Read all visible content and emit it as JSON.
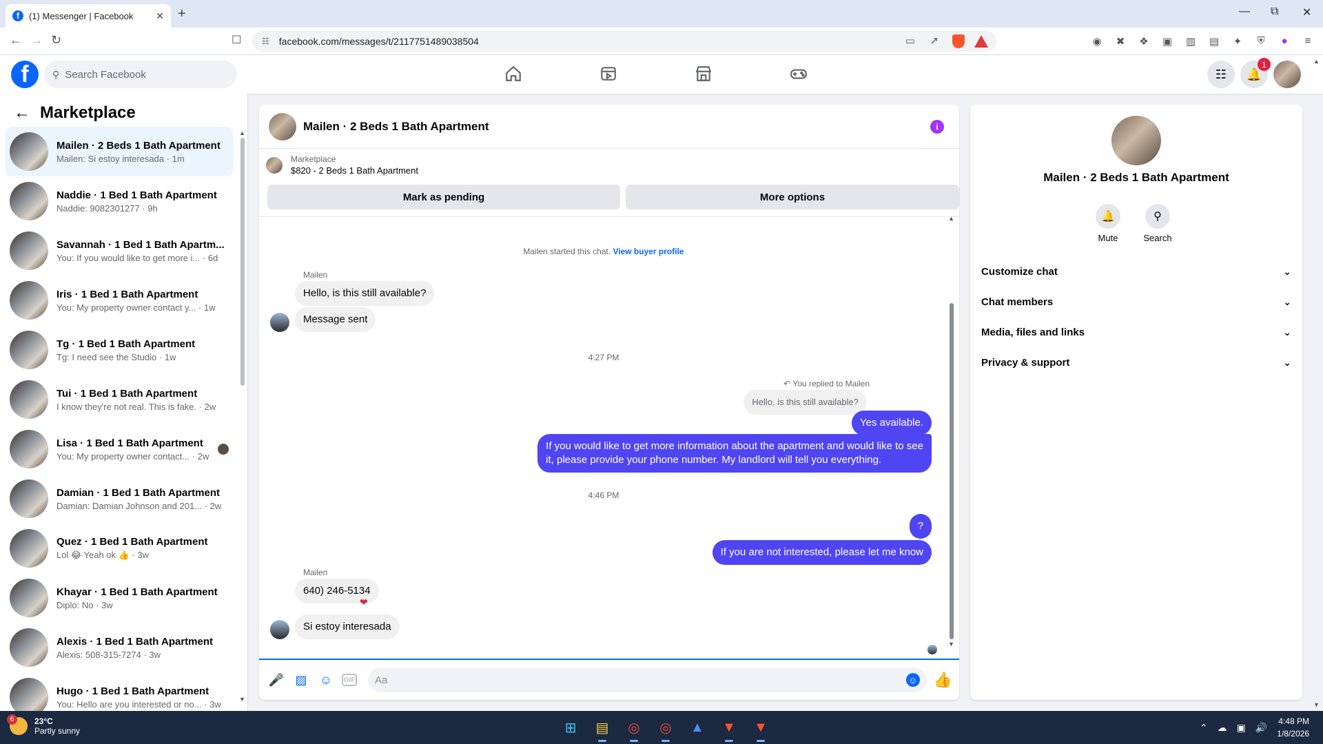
{
  "browser": {
    "tab_title": "(1) Messenger | Facebook",
    "url": "facebook.com/messages/t/2117751489038504",
    "new_tab": "+",
    "close_tab": "✕"
  },
  "fb": {
    "logo": "f",
    "search_placeholder": "Search Facebook",
    "notification_count": "1",
    "nav_icons": [
      "home-icon",
      "video-icon",
      "marketplace-icon",
      "gaming-icon"
    ]
  },
  "sidebar": {
    "title": "Marketplace",
    "conversations": [
      {
        "name": "Mailen · 2 Beds 1 Bath Apartment",
        "preview": "Mailen: Si estoy interesada · 1m",
        "active": true
      },
      {
        "name": "Naddie · 1 Bed 1 Bath Apartment",
        "preview": "Naddie: 9082301277 · 9h"
      },
      {
        "name": "Savannah · 1 Bed 1 Bath Apartm...",
        "preview": "You: If you would like to get more i... · 6d"
      },
      {
        "name": "Iris · 1 Bed 1 Bath Apartment",
        "preview": "You: My property owner contact y... · 1w"
      },
      {
        "name": "Tg · 1 Bed 1 Bath Apartment",
        "preview": "Tg: I need see the Studio · 1w"
      },
      {
        "name": "Tui · 1 Bed 1 Bath Apartment",
        "preview": "I know they're not real. This is fake. · 2w"
      },
      {
        "name": "Lisa · 1 Bed 1 Bath Apartment",
        "preview": "You: My property owner contact... · 2w",
        "seen": true
      },
      {
        "name": "Damian · 1 Bed 1 Bath Apartment",
        "preview": "Damian: Damian Johnson and 201... · 2w"
      },
      {
        "name": "Quez · 1 Bed 1 Bath Apartment",
        "preview": "Lol 😂 Yeah ok 👍 · 3w"
      },
      {
        "name": "Khayar · 1 Bed 1 Bath Apartment",
        "preview": "Diplo: No · 3w"
      },
      {
        "name": "Alexis · 1 Bed 1 Bath Apartment",
        "preview": "Alexis: 508-315-7274 · 3w"
      },
      {
        "name": "Hugo · 1 Bed 1 Bath Apartment",
        "preview": "You: Hello are you interested or no... · 3w"
      }
    ]
  },
  "chat": {
    "title": "Mailen · 2 Beds 1 Bath Apartment",
    "marketplace_label": "Marketplace",
    "listing": "$820 - 2 Beds 1 Bath Apartment",
    "mark_pending": "Mark as pending",
    "more_options": "More options",
    "system_text": "Mailen started this chat.",
    "system_link": "View buyer profile",
    "sender_name": "Mailen",
    "msg_1": "Hello, is this still available?",
    "msg_2": "Message sent",
    "time_1": "4:27 PM",
    "replied_label": "You replied to Mailen",
    "quote": "Hello, is this still available?",
    "msg_3": "Yes available.",
    "msg_4_line1": "If you would like to get more information about the apartment and would like to see",
    "msg_4_line2": "it, please provide your phone number. My landlord will tell you everything.",
    "time_2": "4:46 PM",
    "msg_5": "?",
    "msg_6": "If you are not interested, please let me know",
    "sender_name_2": "Mailen",
    "msg_7": "640) 246-5134",
    "msg_8": "Si estoy interesada",
    "input_placeholder": "Aa"
  },
  "info": {
    "name": "Mailen · 2 Beds 1 Bath Apartment",
    "mute": "Mute",
    "search": "Search",
    "sections": [
      "Customize chat",
      "Chat members",
      "Media, files and links",
      "Privacy & support"
    ]
  },
  "taskbar": {
    "temp": "23°C",
    "weather": "Partly sunny",
    "weather_badge": "6",
    "time": "4:48 PM",
    "date": "1/8/2026"
  },
  "colors": {
    "fb_blue": "#0866ff",
    "outgoing_bubble": "#4f45f2",
    "incoming_bubble": "#f0f0f0",
    "info_purple": "#a033ff"
  }
}
